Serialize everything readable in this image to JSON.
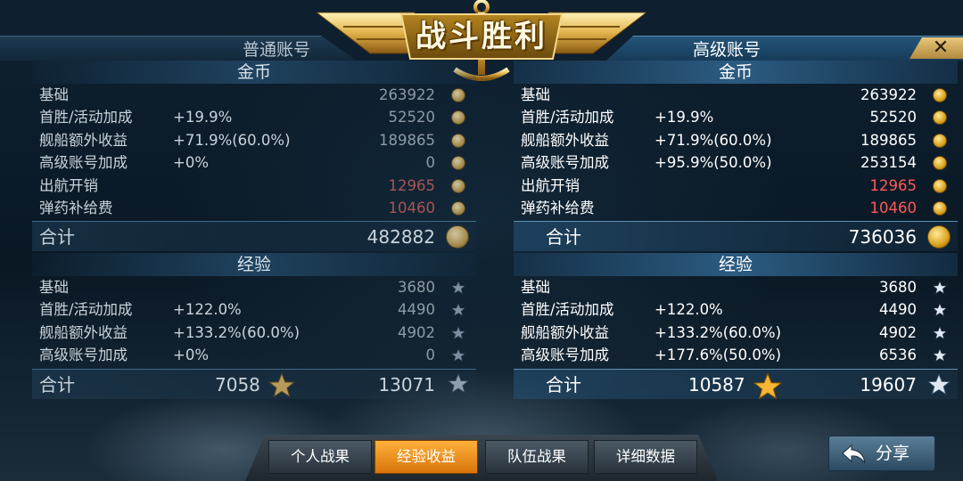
{
  "header": {
    "title": "战斗胜利",
    "normal_account": "普通账号",
    "premium_account": "高级账号",
    "close_symbol": "✕"
  },
  "normal": {
    "gold": {
      "section_title": "金币",
      "rows": [
        {
          "label": "基础",
          "pct": "",
          "value": "263922",
          "negative": false
        },
        {
          "label": "首胜/活动加成",
          "pct": "+19.9%",
          "value": "52520",
          "negative": false
        },
        {
          "label": "舰船额外收益",
          "pct": "+71.9%(60.0%)",
          "value": "189865",
          "negative": false
        },
        {
          "label": "高级账号加成",
          "pct": "+0%",
          "value": "0",
          "negative": false
        },
        {
          "label": "出航开销",
          "pct": "",
          "value": "12965",
          "negative": true
        },
        {
          "label": "弹药补给费",
          "pct": "",
          "value": "10460",
          "negative": true
        }
      ],
      "total_label": "合计",
      "total": "482882"
    },
    "exp": {
      "section_title": "经验",
      "rows": [
        {
          "label": "基础",
          "pct": "",
          "value": "3680"
        },
        {
          "label": "首胜/活动加成",
          "pct": "+122.0%",
          "value": "4490"
        },
        {
          "label": "舰船额外收益",
          "pct": "+133.2%(60.0%)",
          "value": "4902"
        },
        {
          "label": "高级账号加成",
          "pct": "+0%",
          "value": "0"
        }
      ],
      "total_label": "合计",
      "ship_total": "7058",
      "total": "13071"
    }
  },
  "premium": {
    "gold": {
      "section_title": "金币",
      "rows": [
        {
          "label": "基础",
          "pct": "",
          "value": "263922",
          "negative": false
        },
        {
          "label": "首胜/活动加成",
          "pct": "+19.9%",
          "value": "52520",
          "negative": false
        },
        {
          "label": "舰船额外收益",
          "pct": "+71.9%(60.0%)",
          "value": "189865",
          "negative": false
        },
        {
          "label": "高级账号加成",
          "pct": "+95.9%(50.0%)",
          "value": "253154",
          "negative": false
        },
        {
          "label": "出航开销",
          "pct": "",
          "value": "12965",
          "negative": true
        },
        {
          "label": "弹药补给费",
          "pct": "",
          "value": "10460",
          "negative": true
        }
      ],
      "total_label": "合计",
      "total": "736036"
    },
    "exp": {
      "section_title": "经验",
      "rows": [
        {
          "label": "基础",
          "pct": "",
          "value": "3680"
        },
        {
          "label": "首胜/活动加成",
          "pct": "+122.0%",
          "value": "4490"
        },
        {
          "label": "舰船额外收益",
          "pct": "+133.2%(60.0%)",
          "value": "4902"
        },
        {
          "label": "高级账号加成",
          "pct": "+177.6%(50.0%)",
          "value": "6536"
        }
      ],
      "total_label": "合计",
      "ship_total": "10587",
      "total": "19607"
    }
  },
  "tabs": [
    {
      "label": "个人战果",
      "active": false
    },
    {
      "label": "经验收益",
      "active": true
    },
    {
      "label": "队伍战果",
      "active": false
    },
    {
      "label": "详细数据",
      "active": false
    }
  ],
  "share": {
    "label": "分享"
  },
  "colors": {
    "active_tab": "#d8740a",
    "negative_value": "#ff5a5a",
    "coin_gold": "#d9a31e",
    "banner_gold": "#e8c25a"
  },
  "icons": {
    "gold": "coin-icon",
    "exp": "star-icon",
    "ship_exp": "gold-star-icon",
    "share": "share-arrow-icon",
    "close": "close-icon"
  }
}
